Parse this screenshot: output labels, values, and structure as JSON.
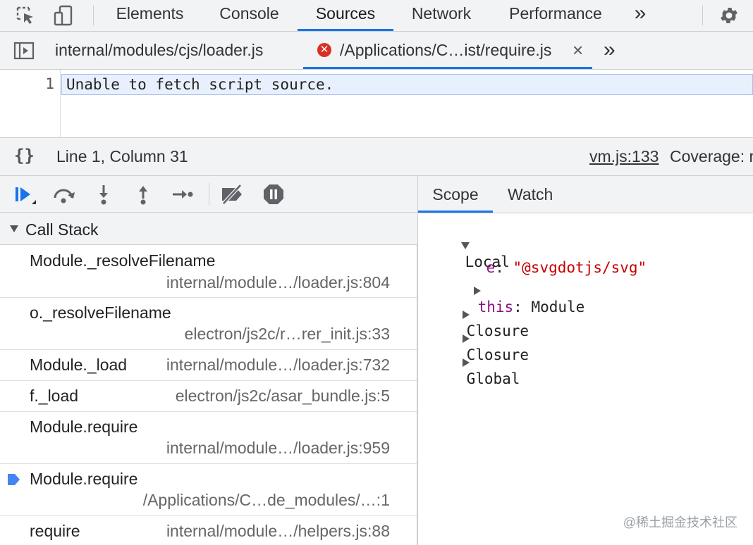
{
  "toolbar": {
    "tabs": [
      "Elements",
      "Console",
      "Sources",
      "Network",
      "Performance"
    ],
    "active_tab": "Sources",
    "more_tabs_glyph": "»",
    "icons": [
      "inspect-element-icon",
      "device-toolbar-icon",
      "more-tabs-icon",
      "settings-gear-icon"
    ]
  },
  "file_tabs": {
    "tab1": "internal/modules/cjs/loader.js",
    "tab2": "/Applications/C…ist/require.js",
    "close_glyph": "×",
    "more_glyph": "»"
  },
  "editor": {
    "line_number": "1",
    "code": "Unable to fetch script source."
  },
  "status_bar": {
    "pretty_print": "{}",
    "position": "Line 1, Column 31",
    "source_link": "vm.js:133",
    "coverage": "Coverage: n"
  },
  "debugger": {
    "buttons": [
      "resume-icon",
      "step-over-icon",
      "step-into-icon",
      "step-out-icon",
      "step-icon",
      "deactivate-breakpoints-icon",
      "pause-on-exceptions-icon"
    ]
  },
  "call_stack": {
    "title": "Call Stack",
    "frames": [
      {
        "name": "Module._resolveFilename",
        "location": "internal/module…/loader.js:804"
      },
      {
        "name": "o._resolveFilename",
        "location": "electron/js2c/r…rer_init.js:33"
      },
      {
        "name": "Module._load",
        "location": "internal/module…/loader.js:732"
      },
      {
        "name": "f._load",
        "location": "electron/js2c/asar_bundle.js:5"
      },
      {
        "name": "Module.require",
        "location": "internal/module…/loader.js:959"
      },
      {
        "name": "Module.require",
        "location": "/Applications/C…de_modules/…:1"
      },
      {
        "name": "require",
        "location": "internal/module…/helpers.js:88"
      }
    ]
  },
  "scope": {
    "tabs": [
      "Scope",
      "Watch"
    ],
    "local_label": "Local",
    "var_name": "e",
    "var_value": "\"@svgdotjs/svg\"",
    "this_name": "this",
    "this_value": "Module",
    "closure1": "Closure",
    "closure2": "Closure",
    "global": "Global"
  },
  "watermark": "@稀土掘金技术社区",
  "colors": {
    "accent": "#1a73e8",
    "error": "#d93025",
    "toolbar_bg": "#f1f3f4",
    "highlight": "#e8f0fe"
  }
}
